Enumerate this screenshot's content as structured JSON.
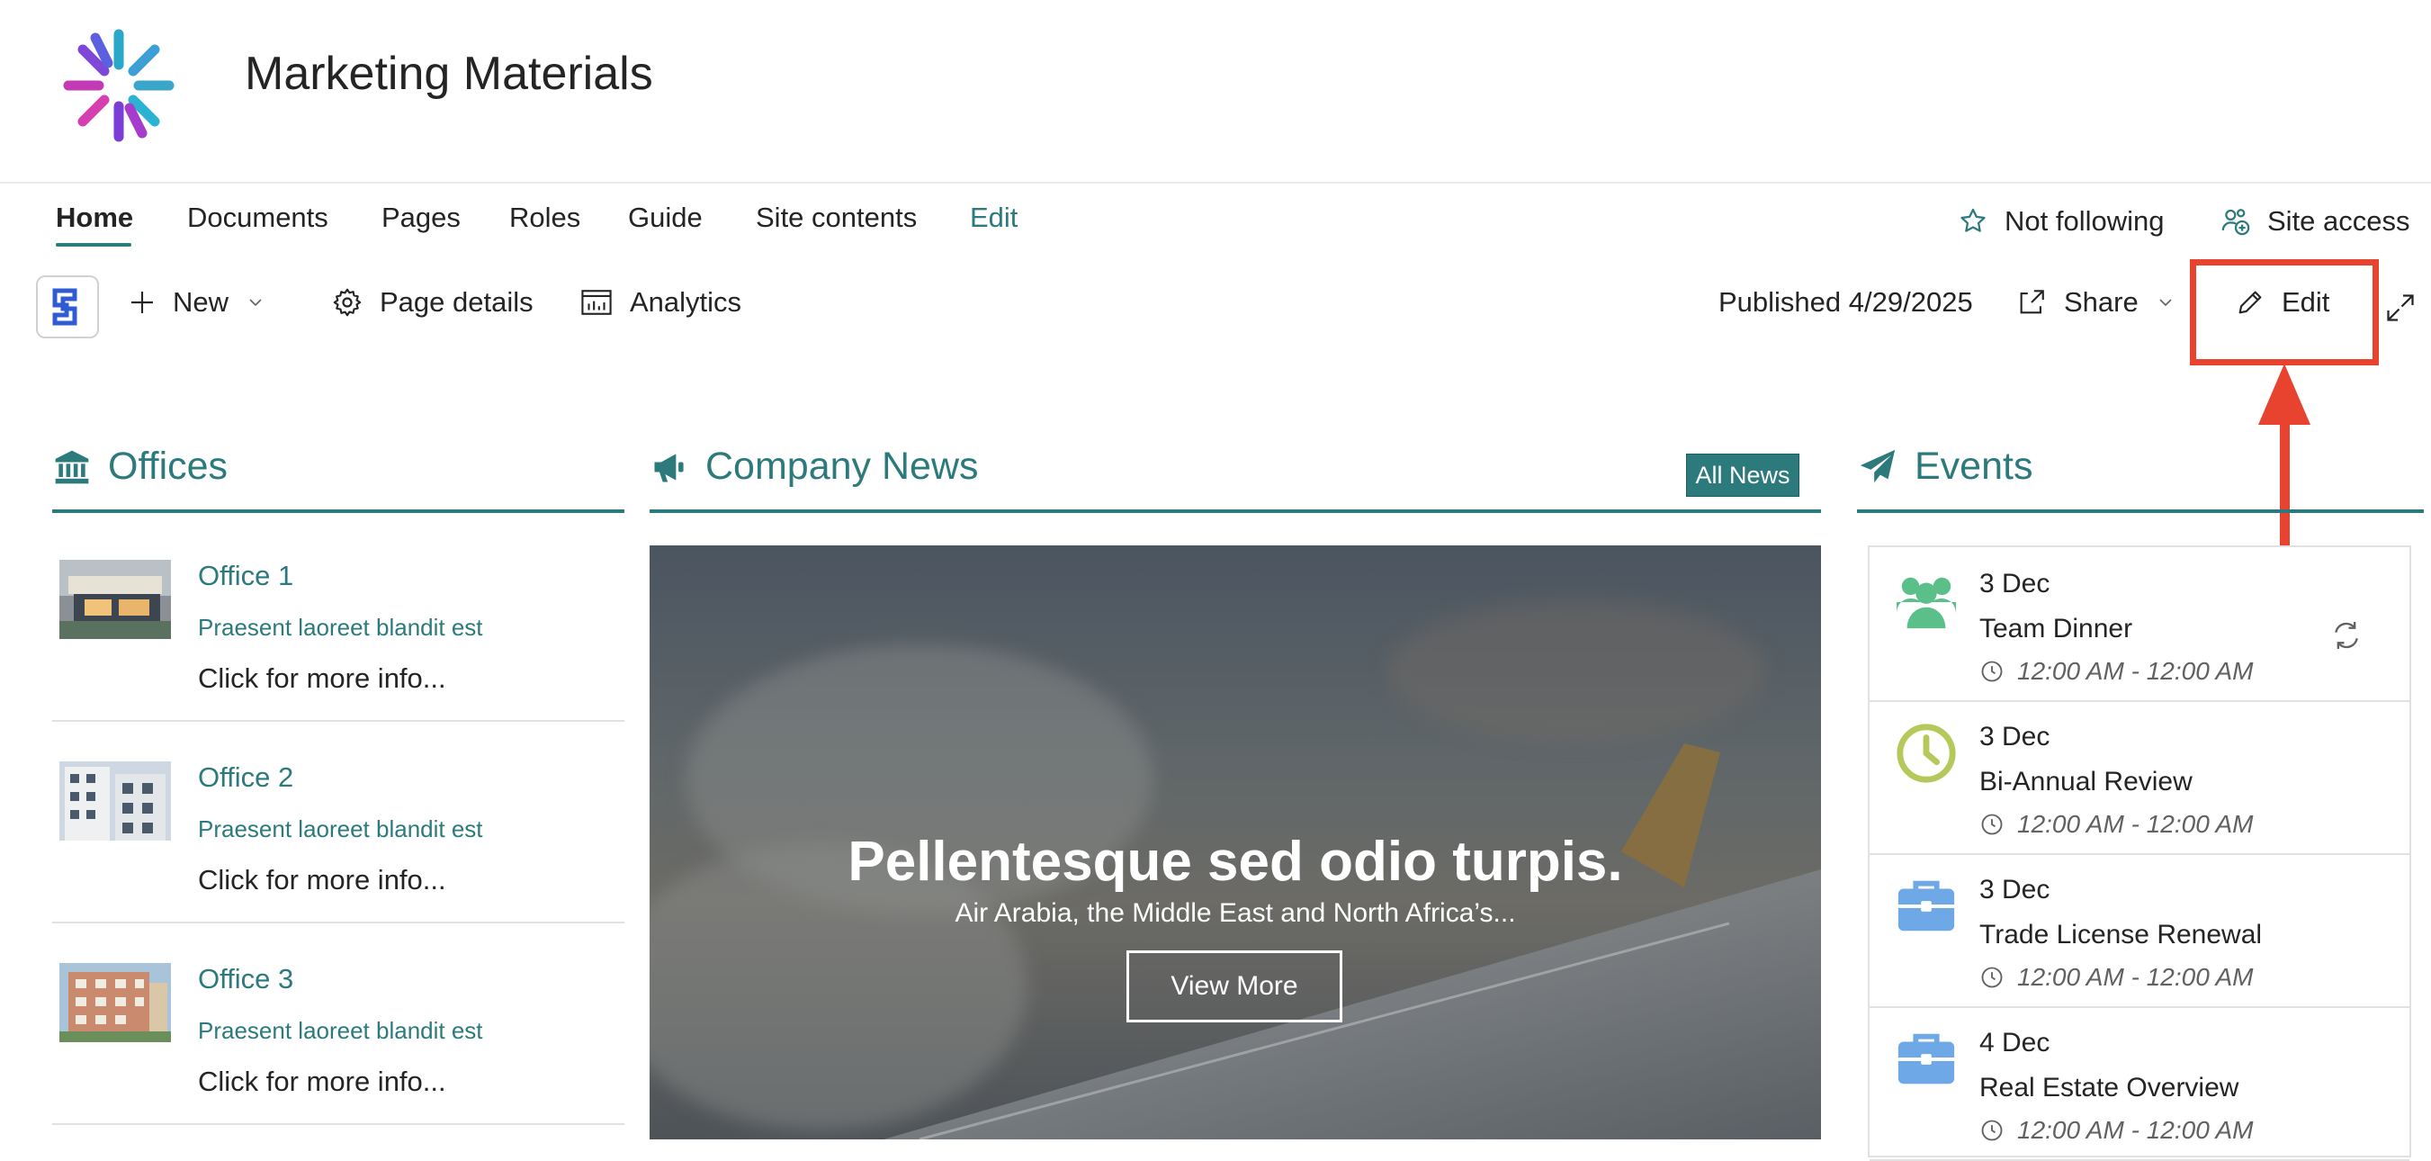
{
  "site": {
    "title": "Marketing Materials"
  },
  "nav": {
    "items": [
      "Home",
      "Documents",
      "Pages",
      "Roles",
      "Guide",
      "Site contents"
    ],
    "edit_label": "Edit",
    "follow_label": "Not following",
    "access_label": "Site access"
  },
  "command_bar": {
    "new_label": "New",
    "page_details_label": "Page details",
    "analytics_label": "Analytics",
    "published_label": "Published 4/29/2025",
    "share_label": "Share",
    "edit_label": "Edit"
  },
  "offices": {
    "title": "Offices",
    "items": [
      {
        "title": "Office 1",
        "subtitle": "Praesent laoreet blandit est",
        "more": "Click for more info..."
      },
      {
        "title": "Office 2",
        "subtitle": "Praesent laoreet blandit est",
        "more": "Click for more info..."
      },
      {
        "title": "Office 3",
        "subtitle": "Praesent laoreet blandit est",
        "more": "Click for more info..."
      }
    ]
  },
  "news": {
    "title": "Company News",
    "all_news_label": "All News",
    "headline": "Pellentesque sed odio turpis.",
    "subtitle": "Air Arabia, the Middle East and North Africa’s...",
    "button_label": "View More"
  },
  "events": {
    "title": "Events",
    "items": [
      {
        "date": "3 Dec",
        "name": "Team Dinner",
        "time": "12:00 AM - 12:00 AM",
        "icon": "people-icon"
      },
      {
        "date": "3 Dec",
        "name": "Bi-Annual Review",
        "time": "12:00 AM - 12:00 AM",
        "icon": "clock-icon"
      },
      {
        "date": "3 Dec",
        "name": "Trade License Renewal",
        "time": "12:00 AM - 12:00 AM",
        "icon": "briefcase-icon"
      },
      {
        "date": "4 Dec",
        "name": "Real Estate Overview",
        "time": "12:00 AM - 12:00 AM",
        "icon": "briefcase-icon"
      }
    ]
  },
  "colors": {
    "accent": "#2c7a7b",
    "highlight": "#e8432e",
    "people_icon": "#5bbf8a",
    "clock_icon": "#b5c95a",
    "briefcase_icon": "#6ea8e6"
  }
}
